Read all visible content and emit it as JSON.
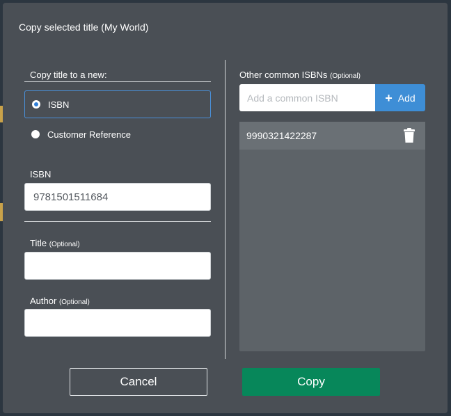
{
  "dialog": {
    "title": "Copy selected title (My World)"
  },
  "copy_to": {
    "label": "Copy title to a new:",
    "options": [
      {
        "label": "ISBN",
        "selected": true
      },
      {
        "label": "Customer Reference",
        "selected": false
      }
    ]
  },
  "fields": {
    "isbn_label": "ISBN",
    "isbn_value": "9781501511684",
    "title_label": "Title",
    "title_optional": "(Optional)",
    "title_value": "",
    "author_label": "Author",
    "author_optional": "(Optional)",
    "author_value": ""
  },
  "common_isbns": {
    "label": "Other common ISBNs",
    "optional": "(Optional)",
    "placeholder": "Add a common ISBN",
    "add_label": "Add",
    "items": [
      "9990321422287"
    ]
  },
  "actions": {
    "cancel_label": "Cancel",
    "copy_label": "Copy"
  },
  "colors": {
    "dialog_bg": "#4a4f55",
    "accent_blue": "#3e8ed6",
    "copy_green": "#07875a"
  }
}
